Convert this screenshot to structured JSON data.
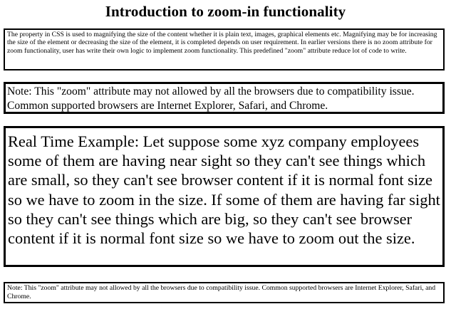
{
  "page": {
    "title": "Introduction to zoom-in functionality"
  },
  "intro": {
    "text": "The property in CSS is used to magnifying the size of the content whether it is plain text, images, graphical elements etc. Magnifying may be for increasing the size of the element or decreasing the size of the element, it is completed depends on user requirement. In earlier versions there is no zoom attribute for zoom functionality, user has write their own logic to implement zoom functionality. This predefined \"zoom\" attribute reduce lot of code to write."
  },
  "note_zoomed": {
    "text": "Note: This \"zoom\" attribute may not allowed by all the browsers due to compatibility issue. Common supported browsers are Internet Explorer, Safari, and Chrome."
  },
  "example": {
    "text": "Real Time Example: Let suppose some xyz company employees some of them are having near sight so they can't see things which are small, so they can't see browser content if it is normal font size so we have to zoom in the size. If some of them are having far sight so they can't see things which are big, so they can't see browser content if it is normal font size so we have to zoom out the size."
  },
  "note_small": {
    "text": "Note: This \"zoom\" attribute may not allowed by all the browsers due to compatibility issue. Common supported browsers are Internet Explorer, Safari, and Chrome."
  }
}
